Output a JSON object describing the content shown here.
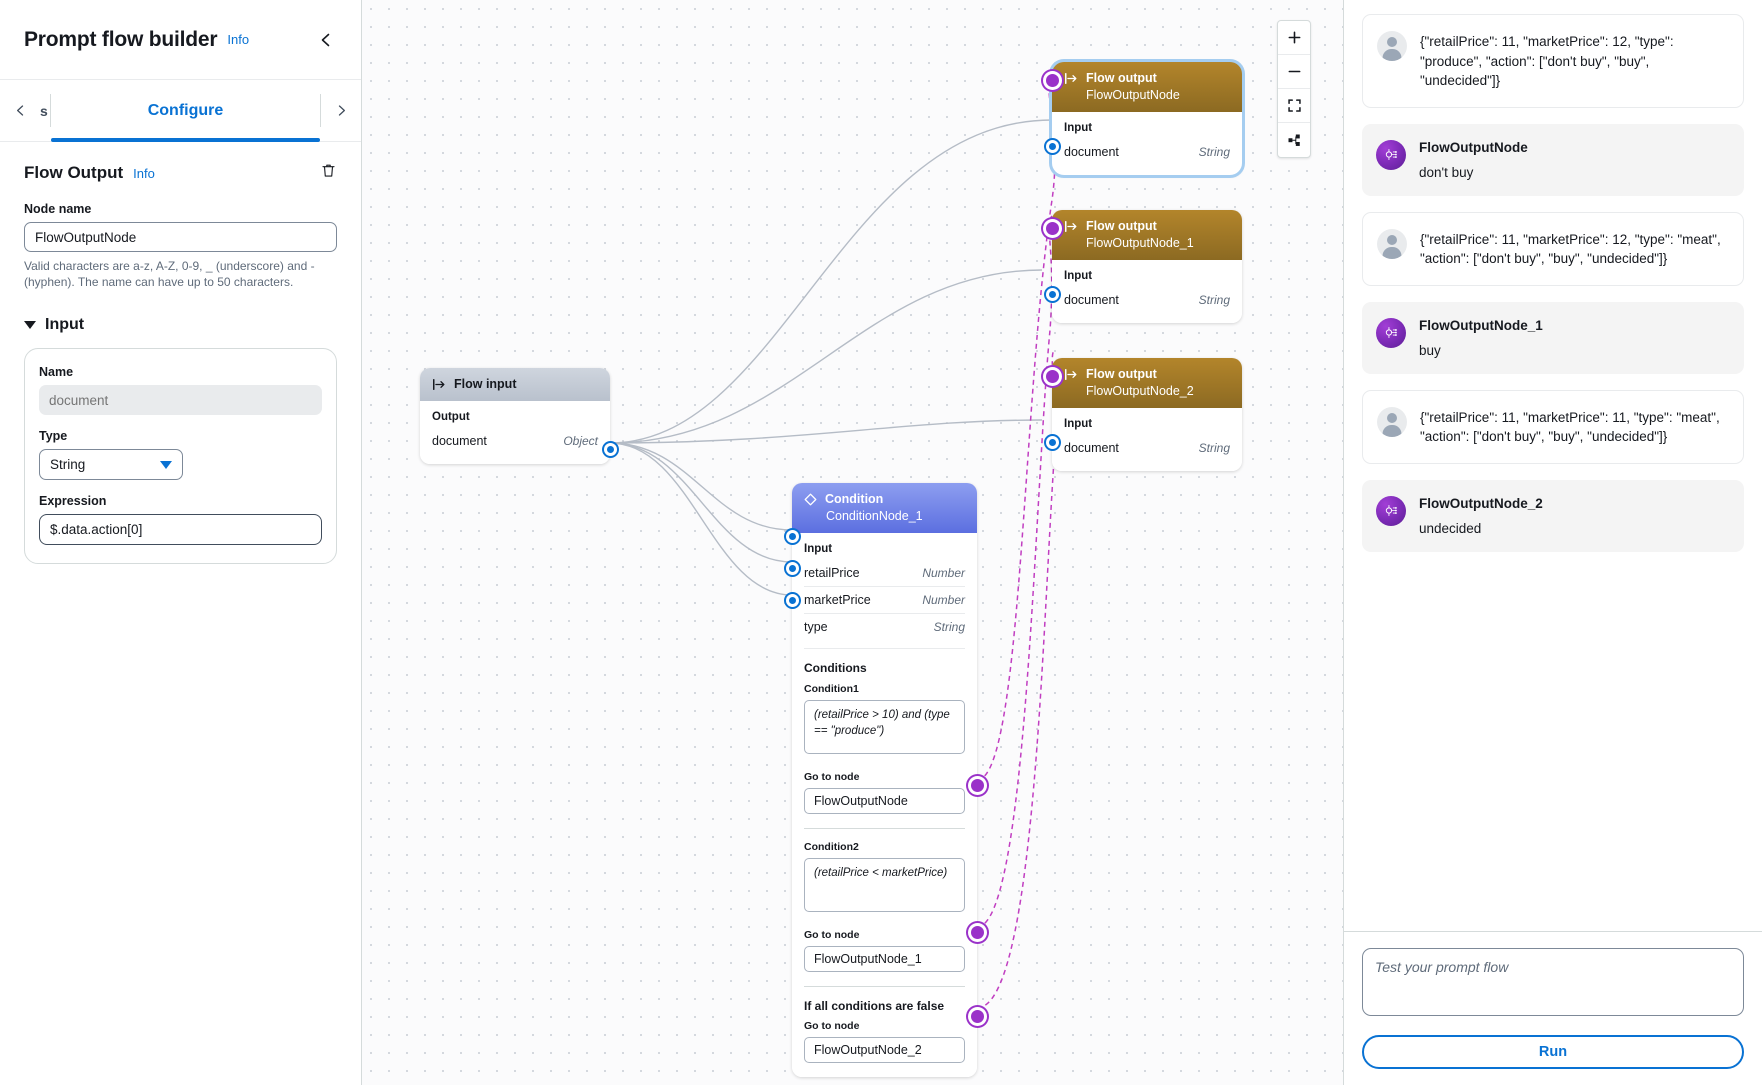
{
  "header": {
    "title": "Prompt flow builder",
    "info_label": "Info",
    "collapse_icon": "chevron-left-icon"
  },
  "tabs": {
    "prev_icon": "chevron-left-icon",
    "next_icon": "chevron-right-icon",
    "clipped_label": "s",
    "active_label": "Configure"
  },
  "configure": {
    "section_title": "Flow Output",
    "section_info": "Info",
    "delete_icon": "trash-icon",
    "node_name_label": "Node name",
    "node_name_value": "FlowOutputNode",
    "node_name_helper": "Valid characters are a-z, A-Z, 0-9, _ (underscore) and -(hyphen). The name can have up to 50 characters.",
    "input_section_label": "Input",
    "name_label": "Name",
    "name_value": "document",
    "type_label": "Type",
    "type_value": "String",
    "expression_label": "Expression",
    "expression_value": "$.data.action[0]"
  },
  "canvas": {
    "controls": [
      {
        "name": "zoom-in-button",
        "icon": "plus-icon"
      },
      {
        "name": "zoom-out-button",
        "icon": "minus-icon"
      },
      {
        "name": "fit-to-screen-button",
        "icon": "expand-icon"
      },
      {
        "name": "auto-layout-button",
        "icon": "layout-icon"
      }
    ],
    "flow_input": {
      "kind": "Flow input",
      "output_label": "Output",
      "rows": [
        {
          "name": "document",
          "type": "Object"
        }
      ]
    },
    "flow_outputs": [
      {
        "kind": "Flow output",
        "name": "FlowOutputNode",
        "input_label": "Input",
        "rows": [
          {
            "name": "document",
            "type": "String"
          }
        ],
        "selected": true
      },
      {
        "kind": "Flow output",
        "name": "FlowOutputNode_1",
        "input_label": "Input",
        "rows": [
          {
            "name": "document",
            "type": "String"
          }
        ],
        "selected": false
      },
      {
        "kind": "Flow output",
        "name": "FlowOutputNode_2",
        "input_label": "Input",
        "rows": [
          {
            "name": "document",
            "type": "String"
          }
        ],
        "selected": false
      }
    ],
    "condition": {
      "kind": "Condition",
      "name": "ConditionNode_1",
      "input_label": "Input",
      "inputs": [
        {
          "name": "retailPrice",
          "type": "Number"
        },
        {
          "name": "marketPrice",
          "type": "Number"
        },
        {
          "name": "type",
          "type": "String"
        }
      ],
      "conditions_label": "Conditions",
      "conditions": [
        {
          "label": "Condition1",
          "expression": "(retailPrice > 10) and (type == \"produce\")",
          "goto_label": "Go to node",
          "goto_value": "FlowOutputNode"
        },
        {
          "label": "Condition2",
          "expression": "(retailPrice < marketPrice)",
          "goto_label": "Go to node",
          "goto_value": "FlowOutputNode_1"
        }
      ],
      "else_title": "If all conditions are false",
      "else_goto_label": "Go to node",
      "else_goto_value": "FlowOutputNode_2"
    }
  },
  "chat": {
    "messages": [
      {
        "role": "user",
        "text": "{\"retailPrice\": 11, \"marketPrice\": 12, \"type\": \"produce\", \"action\": [\"don't buy\", \"buy\", \"undecided\"]}"
      },
      {
        "role": "bot",
        "title": "FlowOutputNode",
        "text": "don't buy"
      },
      {
        "role": "user",
        "text": "{\"retailPrice\": 11, \"marketPrice\": 12, \"type\": \"meat\", \"action\": [\"don't buy\", \"buy\", \"undecided\"]}"
      },
      {
        "role": "bot",
        "title": "FlowOutputNode_1",
        "text": "buy"
      },
      {
        "role": "user",
        "text": "{\"retailPrice\": 11, \"marketPrice\": 11, \"type\": \"meat\", \"action\": [\"don't buy\", \"buy\", \"undecided\"]}"
      },
      {
        "role": "bot",
        "title": "FlowOutputNode_2",
        "text": "undecided"
      }
    ],
    "input_placeholder": "Test your prompt flow",
    "input_value": "",
    "run_label": "Run"
  },
  "colors": {
    "accent_blue": "#0972d3",
    "flow_output_brown": "#8c6a22",
    "condition_blue": "#5c6fe0",
    "wire_purple": "#c13ec1",
    "bot_purple": "#7b2ab5"
  }
}
